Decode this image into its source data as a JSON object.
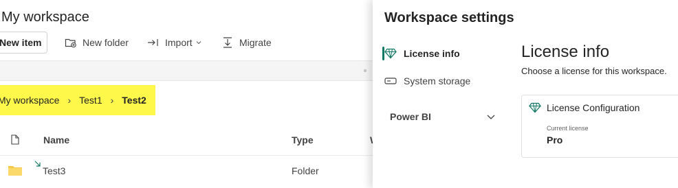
{
  "workspace": {
    "title": "My workspace",
    "toolbar": {
      "new_item": "New item",
      "new_folder": "New folder",
      "import": "Import",
      "migrate": "Migrate"
    },
    "breadcrumb": [
      "My workspace",
      "Test1",
      "Test2"
    ],
    "table": {
      "columns": [
        "Name",
        "Type",
        "W"
      ],
      "rows": [
        {
          "name": "Test3",
          "type": "Folder"
        }
      ]
    },
    "highlight_color": "#fdf84a"
  },
  "settings": {
    "title": "Workspace settings",
    "nav": {
      "license_info": "License info",
      "system_storage": "System storage",
      "power_bi": "Power BI"
    },
    "content": {
      "title": "License info",
      "subtitle": "Choose a license for this workspace.",
      "card": {
        "heading": "License Configuration",
        "current_license_label": "Current license",
        "current_license_value": "Pro"
      }
    },
    "accent_color": "#117865"
  }
}
